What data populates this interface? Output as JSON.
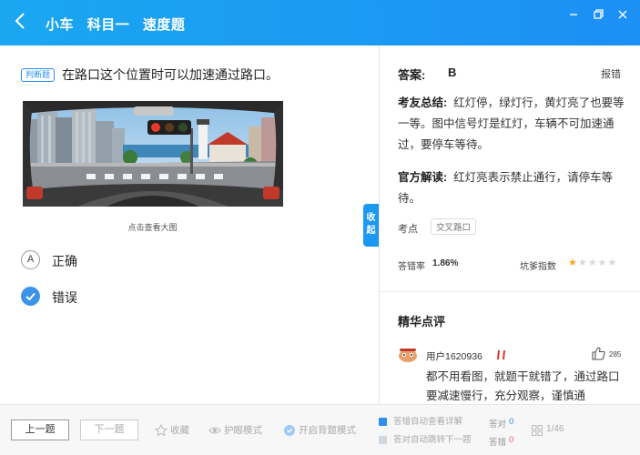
{
  "header": {
    "back_icon": "chevron-left-icon",
    "crumbs": [
      "小车",
      "科目一",
      "速度题"
    ],
    "window_controls": [
      "minimize-icon",
      "maximize-icon",
      "close-icon"
    ]
  },
  "question": {
    "type_badge": "判断题",
    "text": "在路口这个位置时可以加速通过路口。",
    "image_caption": "点击查看大图",
    "options": [
      {
        "key": "A",
        "label": "正确",
        "selected": false
      },
      {
        "key": "",
        "label": "错误",
        "selected": true
      }
    ]
  },
  "collapse_tab": {
    "line1": "收",
    "line2": "起"
  },
  "answer": {
    "label": "答案:",
    "value": "B",
    "report_label": "报错"
  },
  "summary": {
    "label": "考友总结:",
    "text": "红灯停，绿灯行，黄灯亮了也要等一等。图中信号灯是红灯，车辆不可加速通过，要停车等待。"
  },
  "official": {
    "label": "官方解读:",
    "text": "红灯亮表示禁止通行，请停车等待。"
  },
  "knowledge": {
    "label": "考点",
    "tag": "交叉路口"
  },
  "stats": {
    "error_rate_label": "答错率",
    "error_rate": "1.86%",
    "difficulty_label": "坑爹指数",
    "difficulty": 1,
    "difficulty_max": 5
  },
  "comments": {
    "title": "精华点评",
    "items": [
      {
        "user": "用户1620936",
        "likes": "285",
        "text": "都不用看图，就题干就错了，通过路口要减速慢行，充分观察，谨慎通"
      }
    ]
  },
  "footer": {
    "prev_label": "上一题",
    "next_label": "下一题",
    "favorite_label": "收藏",
    "eye_mode_label": "护眼模式",
    "recite_label": "开启背题模式",
    "auto_explain_label": "答错自动查看详解",
    "auto_explain_on": true,
    "auto_next_label": "答对自动跳转下一题",
    "auto_next_on": false,
    "correct_label": "答对",
    "correct_count": "0",
    "wrong_label": "答错",
    "wrong_count": "0",
    "page": "1/46"
  },
  "colors": {
    "accent": "#1c8ff5",
    "star": "#f5a623",
    "wrong": "#e36a5a"
  }
}
